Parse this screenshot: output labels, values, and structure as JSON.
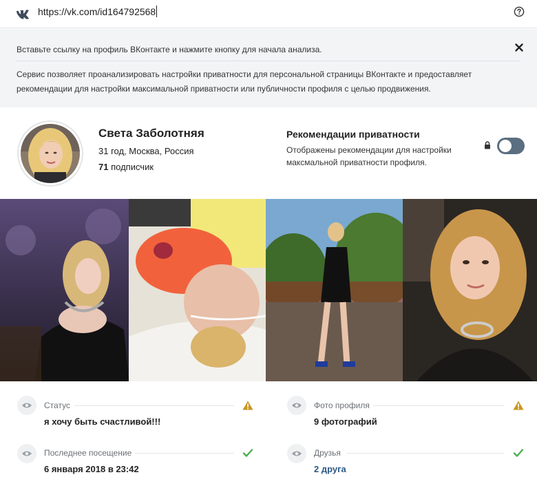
{
  "topbar": {
    "url": "https://vk.com/id164792568",
    "vk_icon": "vk-logo-icon",
    "help_icon": "question-circle-icon"
  },
  "info": {
    "instruction": "Вставьте ссылку на профиль ВКонтакте и нажмите кнопку для начала анализа.",
    "description_line1": "Сервис позволяет проанализировать настройки приватности для персональной страницы ВКонтакте и предоставляет",
    "description_line2": "рекомендации для настройки максимальной приватности или публичности профиля с целью продвижения.",
    "close_icon": "close-icon"
  },
  "profile": {
    "name": "Света Заболотняя",
    "location": "31 год, Москва, Россия",
    "subscribers_count": "71",
    "subscribers_label": " подписчик"
  },
  "recommendations": {
    "title": "Рекомендации приватности",
    "description": "Отображены рекомендации для настройки максмальной приватности профиля.",
    "toggle_on": false,
    "lock_icon": "lock-icon"
  },
  "photos": [
    {
      "name": "photo-1"
    },
    {
      "name": "photo-2"
    },
    {
      "name": "photo-3"
    },
    {
      "name": "photo-4"
    }
  ],
  "fields": {
    "status": {
      "label": "Статус",
      "value": "я хочу быть счастливой!!!",
      "indicator": "warning-icon"
    },
    "photo": {
      "label": "Фото профиля",
      "value": "9 фотографий",
      "indicator": "warning-icon"
    },
    "last_seen": {
      "label": "Последнее посещение",
      "value": "6 января 2018 в 23:42",
      "indicator": "check-icon"
    },
    "friends": {
      "label": "Друзья",
      "value": "2 друга",
      "indicator": "check-icon"
    }
  },
  "colors": {
    "warning": "#c8961e",
    "check": "#4caf50",
    "link": "#2a5885",
    "toggle_off": "#5b6f80"
  }
}
